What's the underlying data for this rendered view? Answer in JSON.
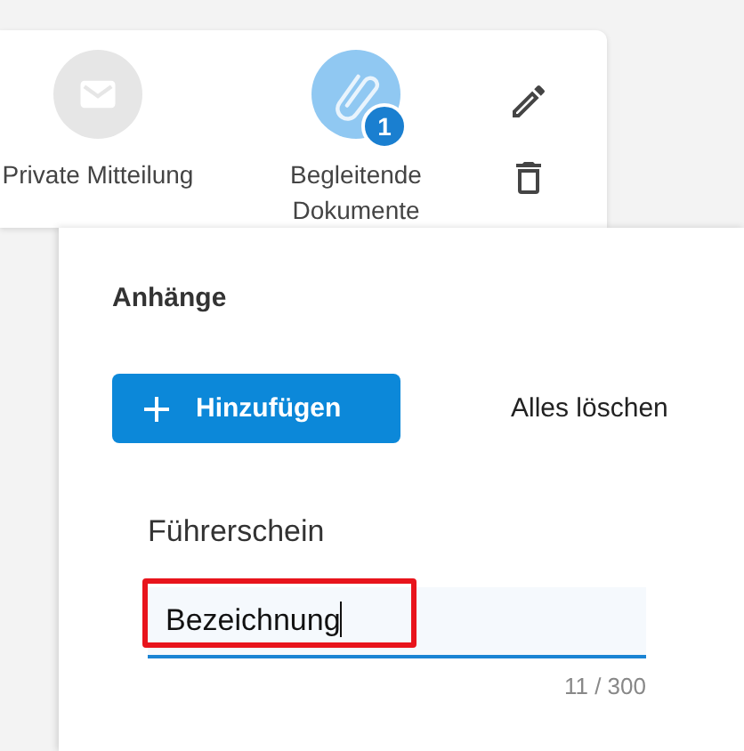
{
  "card": {
    "items": [
      {
        "kind": "mail",
        "label": "Private Mitteilung",
        "selected": false
      },
      {
        "kind": "paperclip",
        "label": "Begleitende Dokumente",
        "selected": true,
        "badge": "1"
      }
    ]
  },
  "panel": {
    "title": "Anhänge",
    "add_button": "Hinzufügen",
    "clear_button": "Alles löschen",
    "attachment": {
      "name": "Führerschein",
      "field": {
        "value": "Bezeichnung",
        "focused": true,
        "highlighted": true
      },
      "counter": "11 / 300"
    }
  }
}
